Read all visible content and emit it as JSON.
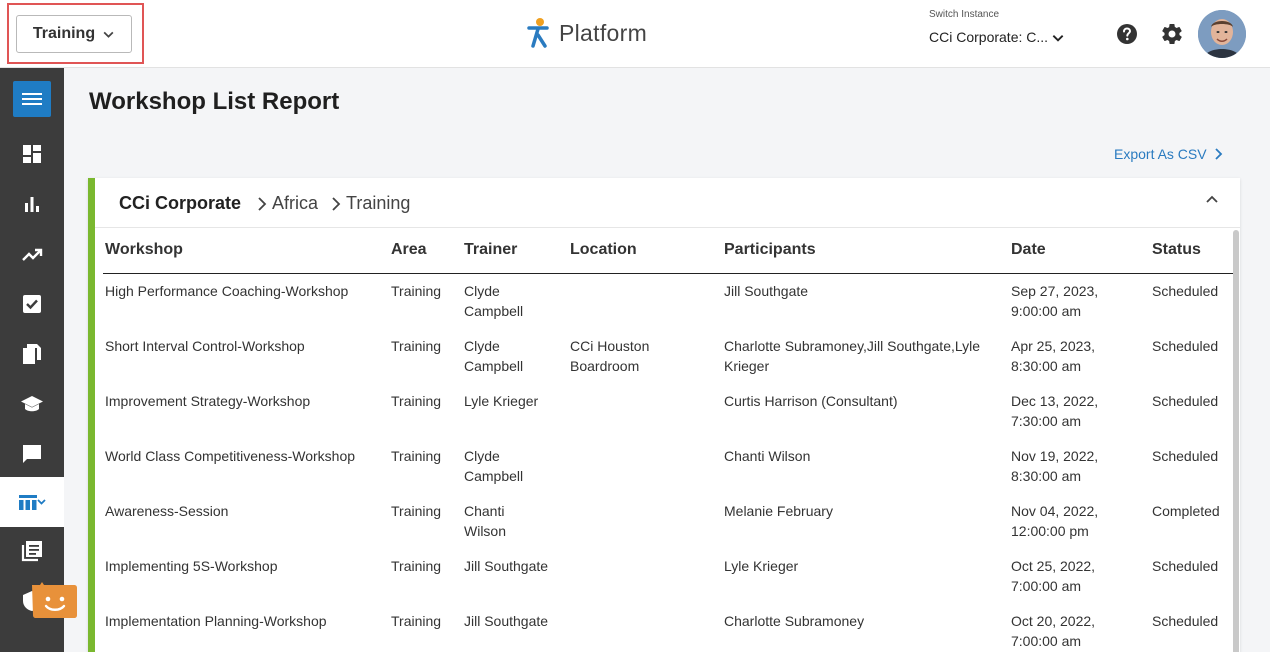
{
  "topbar": {
    "instance_button_label": "Training",
    "app_name": "Platform",
    "switch_label": "Switch Instance",
    "switch_value": "CCi Corporate: C..."
  },
  "page": {
    "title": "Workshop List Report",
    "export_label": "Export As CSV"
  },
  "breadcrumb": {
    "root": "CCi Corporate",
    "items": [
      "Africa",
      "Training"
    ]
  },
  "table": {
    "columns": [
      "Workshop",
      "Area",
      "Trainer",
      "Location",
      "Participants",
      "Date",
      "Status"
    ],
    "rows": [
      {
        "workshop": "High Performance Coaching-Workshop",
        "area": "Training",
        "trainer": [
          "Clyde",
          "Campbell"
        ],
        "location": [],
        "participants": [
          "Jill Southgate"
        ],
        "date": [
          "Sep 27, 2023,",
          "9:00:00 am"
        ],
        "status": "Scheduled"
      },
      {
        "workshop": "Short Interval Control-Workshop",
        "area": "Training",
        "trainer": [
          "Clyde",
          "Campbell"
        ],
        "location": [
          "CCi Houston",
          "Boardroom"
        ],
        "participants": [
          "Charlotte Subramoney,Jill Southgate,Lyle",
          "Krieger"
        ],
        "date": [
          "Apr 25, 2023,",
          "8:30:00 am"
        ],
        "status": "Scheduled"
      },
      {
        "workshop": "Improvement Strategy-Workshop",
        "area": "Training",
        "trainer": [
          "Lyle Krieger"
        ],
        "location": [],
        "participants": [
          "Curtis Harrison (Consultant)"
        ],
        "date": [
          "Dec 13, 2022,",
          "7:30:00 am"
        ],
        "status": "Scheduled"
      },
      {
        "workshop": "World Class Competitiveness-Workshop",
        "area": "Training",
        "trainer": [
          "Clyde",
          "Campbell"
        ],
        "location": [],
        "participants": [
          "Chanti Wilson"
        ],
        "date": [
          "Nov 19, 2022,",
          "8:30:00 am"
        ],
        "status": "Scheduled"
      },
      {
        "workshop": "Awareness-Session",
        "area": "Training",
        "trainer": [
          "Chanti",
          "Wilson"
        ],
        "location": [],
        "participants": [
          "Melanie February"
        ],
        "date": [
          "Nov 04, 2022,",
          "12:00:00 pm"
        ],
        "status": "Completed"
      },
      {
        "workshop": "Implementing 5S-Workshop",
        "area": "Training",
        "trainer": [
          "Jill Southgate"
        ],
        "location": [],
        "participants": [
          "Lyle Krieger"
        ],
        "date": [
          "Oct 25, 2022,",
          "7:00:00 am"
        ],
        "status": "Scheduled"
      },
      {
        "workshop": "Implementation Planning-Workshop",
        "area": "Training",
        "trainer": [
          "Jill Southgate"
        ],
        "location": [],
        "participants": [
          "Charlotte Subramoney"
        ],
        "date": [
          "Oct 20, 2022,",
          "7:00:00 am"
        ],
        "status": "Scheduled"
      }
    ]
  },
  "colors": {
    "accent_blue": "#1f7cc4",
    "card_accent_green": "#7ab82f",
    "highlight_red": "#e05555",
    "link_blue": "#2a7bc0",
    "sidebar_bg": "#3c3c3c"
  },
  "sidebar": {
    "icons": [
      "menu-icon",
      "dashboard-icon",
      "bar-chart-icon",
      "trend-icon",
      "checkbox-icon",
      "documents-icon",
      "graduation-cap-icon",
      "chat-icon",
      "workshop-report-icon",
      "news-icon",
      "shield-icon"
    ]
  }
}
